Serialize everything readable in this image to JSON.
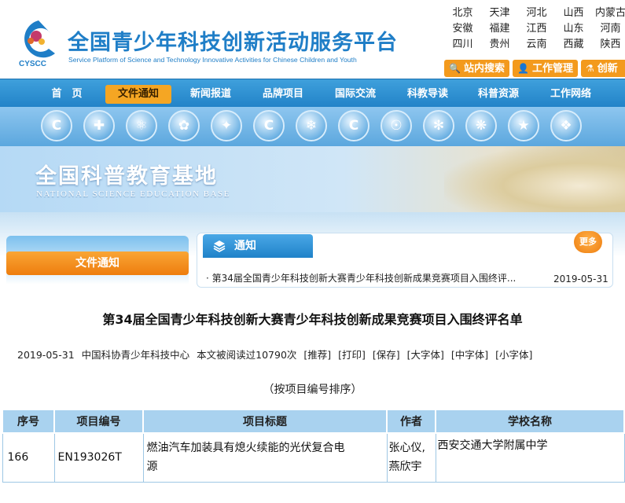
{
  "header": {
    "title": "全国青少年科技创新活动服务平台",
    "subtitle": "Service Platform of Science and Technology Innovative Activities for Chinese Children and Youth",
    "logo_text": "CYSCC",
    "regions": [
      "北京",
      "天津",
      "河北",
      "山西",
      "内蒙古",
      "安徽",
      "福建",
      "江西",
      "山东",
      "河南",
      "四川",
      "贵州",
      "云南",
      "西藏",
      "陕西"
    ],
    "quick_links": [
      "站内搜索",
      "工作管理",
      "创新"
    ]
  },
  "nav": {
    "items": [
      "首　页",
      "文件通知",
      "新闻报道",
      "品牌项目",
      "国际交流",
      "科教导读",
      "科普资源",
      "工作网络"
    ],
    "active": "文件通知"
  },
  "icon_strip": {
    "icons": [
      "cyscc-logo-icon",
      "clinic-icon",
      "atom-icon",
      "calligraphy-icon",
      "star-figure-icon",
      "cyscc-logo-icon",
      "dance-icon",
      "cyscc-logo-icon",
      "globe-icon",
      "swirl-icon",
      "network-icon",
      "star-badge-icon",
      "emblem-icon"
    ]
  },
  "banner": {
    "title": "全国科普教育基地",
    "subtitle": "NATIONAL SCIENCE EDUCATION BASE"
  },
  "sidebar": {
    "tab_label": "文件通知"
  },
  "notice": {
    "heading": "通知",
    "more_label": "更多",
    "item_title": "· 第34届全国青少年科技创新大赛青少年科技创新成果竞赛项目入围终评...",
    "item_date": "2019-05-31"
  },
  "article": {
    "title": "第34届全国青少年科技创新大赛青少年科技创新成果竞赛项目入围终评名单",
    "meta": {
      "date": "2019-05-31",
      "source": "中国科协青少年科技中心",
      "views": "本文被阅读过10790次",
      "links": [
        "[推荐]",
        "[打印]",
        "[保存]",
        "[大字体]",
        "[中字体]",
        "[小字体]"
      ]
    },
    "sort_note": "（按项目编号排序）"
  },
  "table": {
    "headers": [
      "序号",
      "项目编号",
      "项目标题",
      "作者",
      "学校名称"
    ],
    "rows": [
      {
        "no": "166",
        "code": "EN193026T",
        "title_line1": "燃油汽车加装具有熄火续能的光伏复合电",
        "title_line2": "源",
        "author_line1": "张心仪,",
        "author_line2": "燕欣宇",
        "school": "西安交通大学附属中学"
      }
    ]
  },
  "colors": {
    "brand_blue": "#1f7ec7",
    "nav_blue": "#2283c8",
    "accent_orange": "#f39a1d",
    "table_header": "#a9d2ef"
  }
}
